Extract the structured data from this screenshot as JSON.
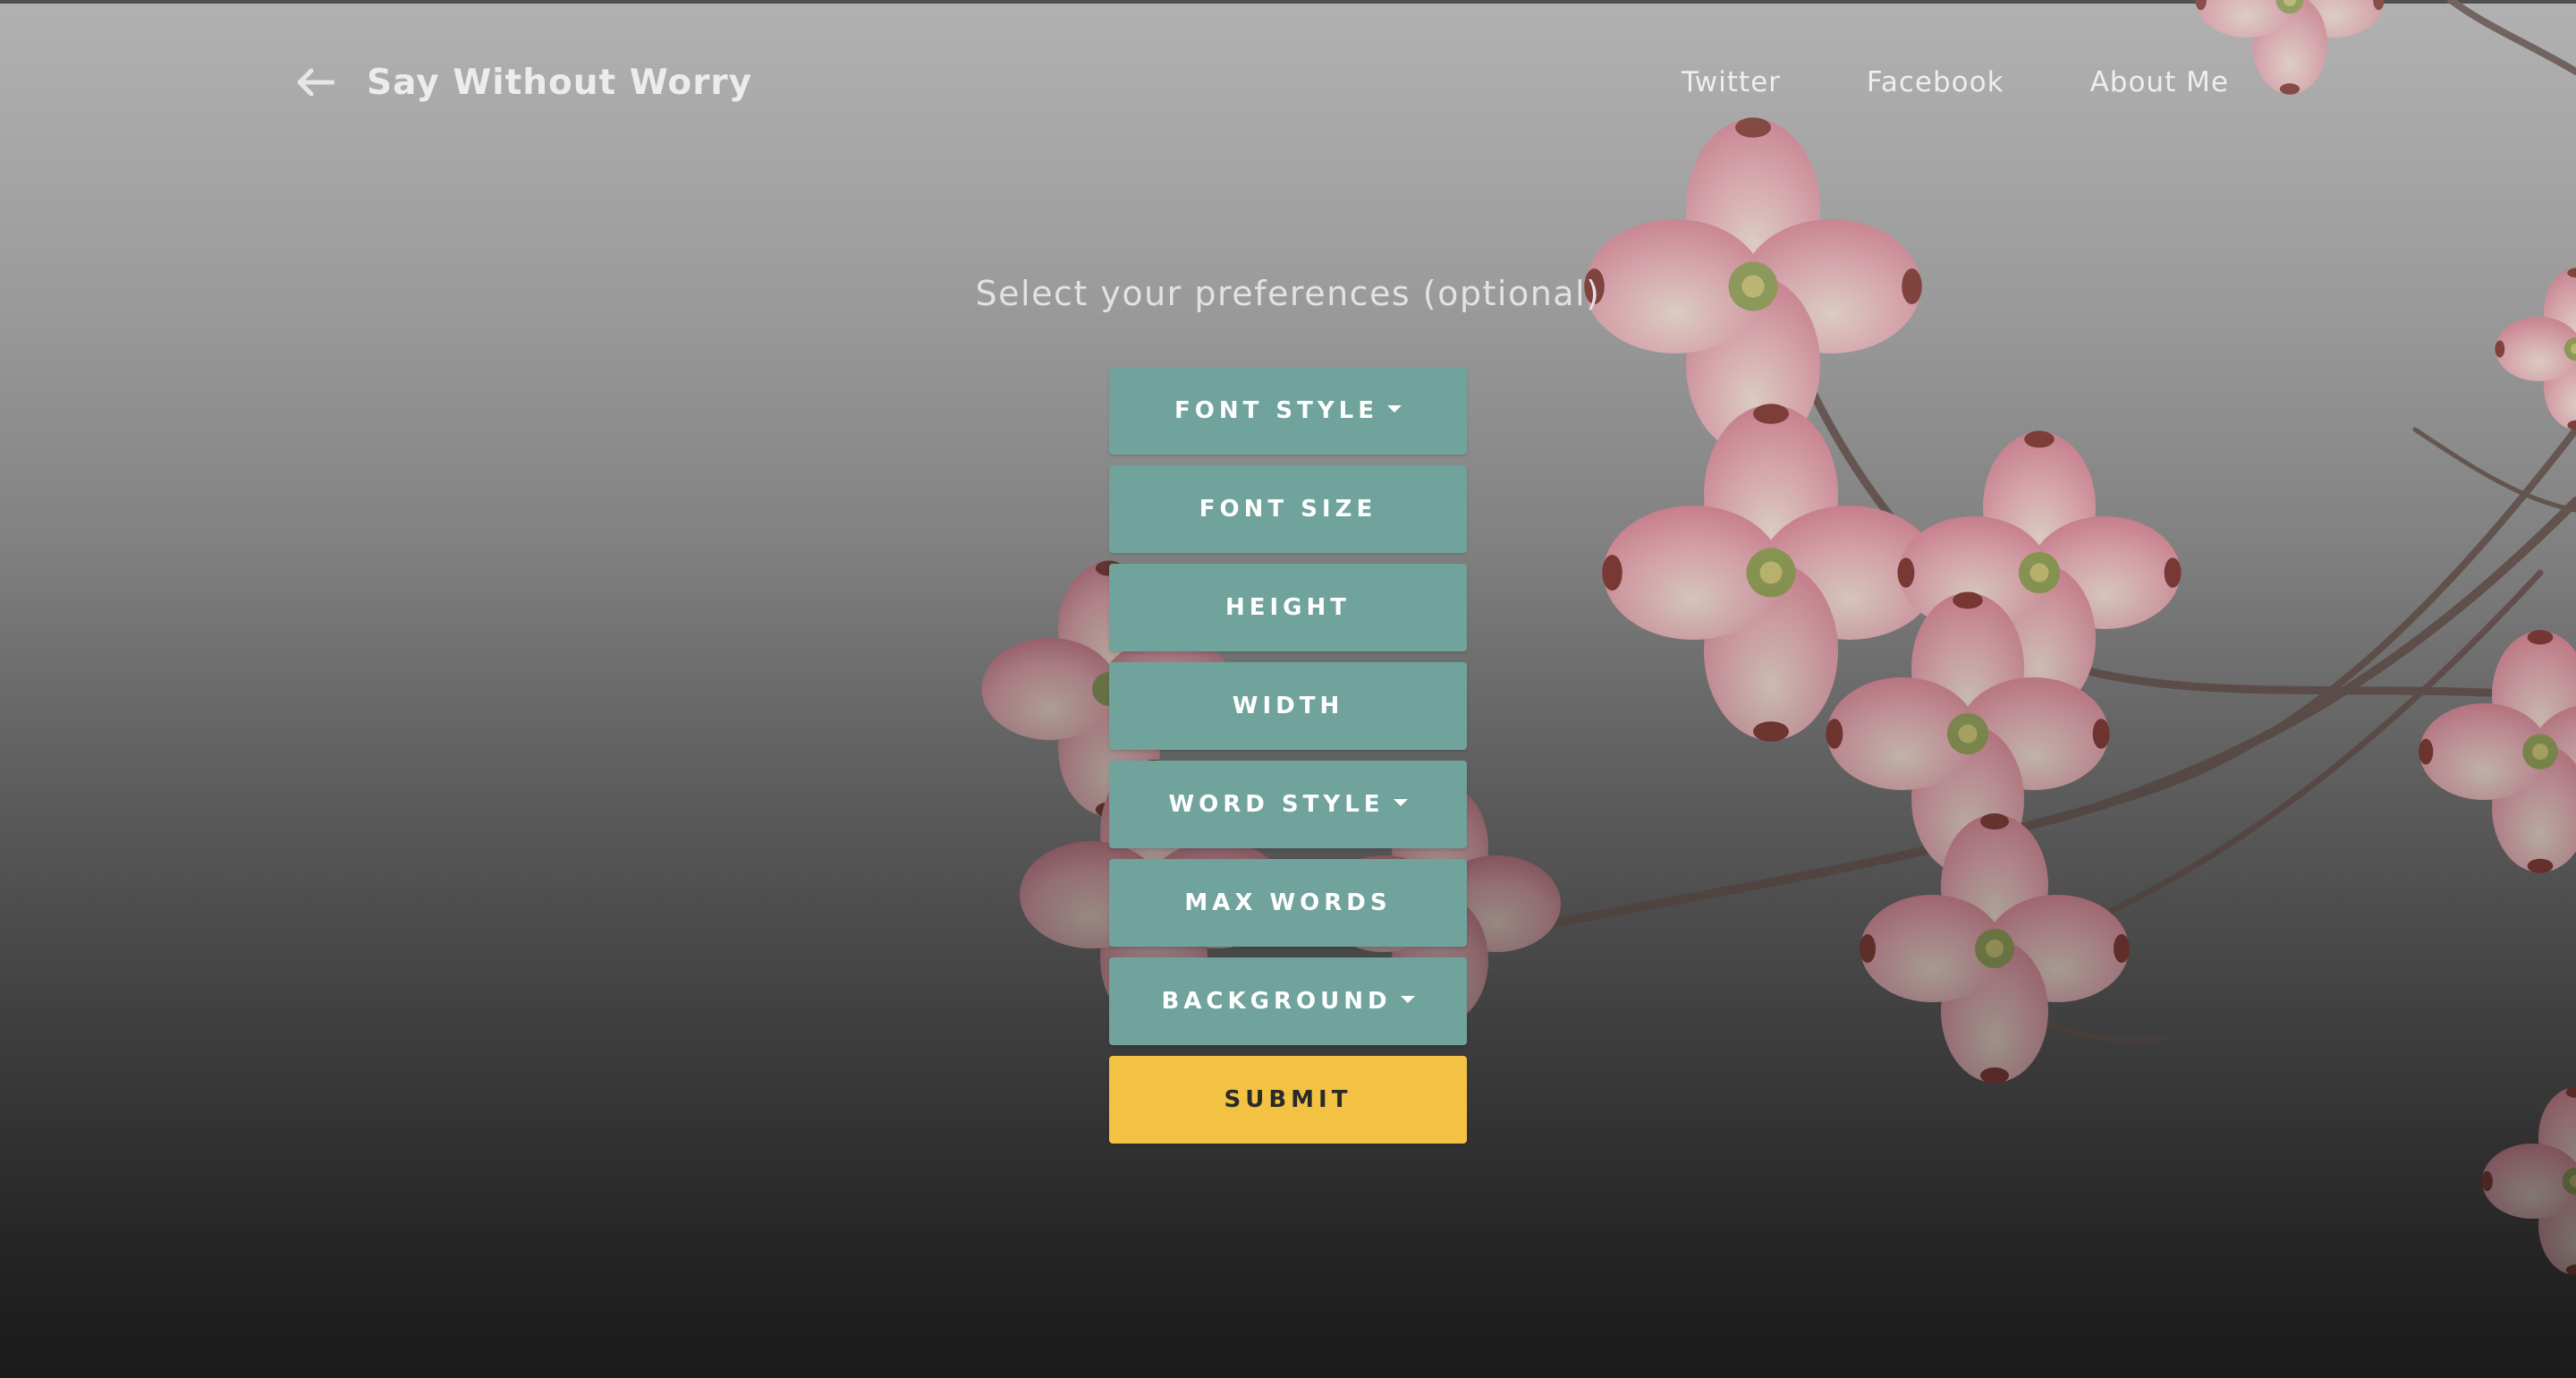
{
  "header": {
    "brand": "Say Without Worry",
    "back_icon": "arrow-left-icon",
    "links": [
      "Twitter",
      "Facebook",
      "About Me"
    ]
  },
  "main": {
    "subtitle": "Select your preferences (optional)",
    "buttons": {
      "font_style": "FONT STYLE",
      "font_size": "FONT SIZE",
      "height": "HEIGHT",
      "width": "WIDTH",
      "word_style": "WORD STYLE",
      "max_words": "MAX WORDS",
      "background": "BACKGROUND",
      "submit": "SUBMIT"
    },
    "dropdown_icon": "caret-down-icon"
  },
  "colors": {
    "option_button": "#6fa39c",
    "submit_button": "#f4c242",
    "text": "#eeeeee",
    "background_top": "#b4b4b4",
    "background_bottom": "#1e1e1e"
  }
}
